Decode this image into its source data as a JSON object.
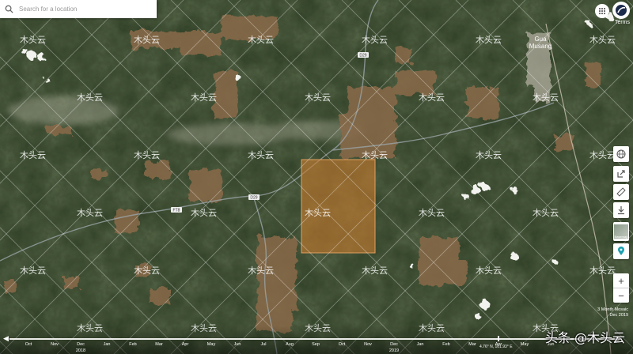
{
  "search": {
    "placeholder": "Search for a location"
  },
  "header": {
    "terms": "Terms"
  },
  "map": {
    "place_label": "Gua\nMusang",
    "road_labels": [
      "D29",
      "D29",
      "FT8"
    ],
    "selection_color": "#c77a2e"
  },
  "tools": [
    "globe-icon",
    "share-icon",
    "ruler-icon",
    "download-icon",
    "basemap-icon",
    "location-pin-icon"
  ],
  "basemap_label": "Basemap",
  "zoom": {
    "in": "+",
    "out": "−"
  },
  "mosaic_label": "3 Month Mosaic",
  "mosaic_date": "Dec 2019",
  "timeline": {
    "months": [
      "Oct",
      "Nov",
      "Dec",
      "Jan",
      "Feb",
      "Mar",
      "Apr",
      "May",
      "Jun",
      "Jul",
      "Aug",
      "Sep",
      "Oct",
      "Nov",
      "Dec",
      "Jan",
      "Feb",
      "Mar",
      "Apr",
      "May",
      "Jun"
    ],
    "years": [
      {
        "label": "2018",
        "at_month": 2
      },
      {
        "label": "2019",
        "at_month": 14
      }
    ],
    "selected_month": 18
  },
  "coords": "4.76° N, 101.93° E",
  "watermark": {
    "text": "木头云"
  },
  "banner": "头条 @木头云"
}
